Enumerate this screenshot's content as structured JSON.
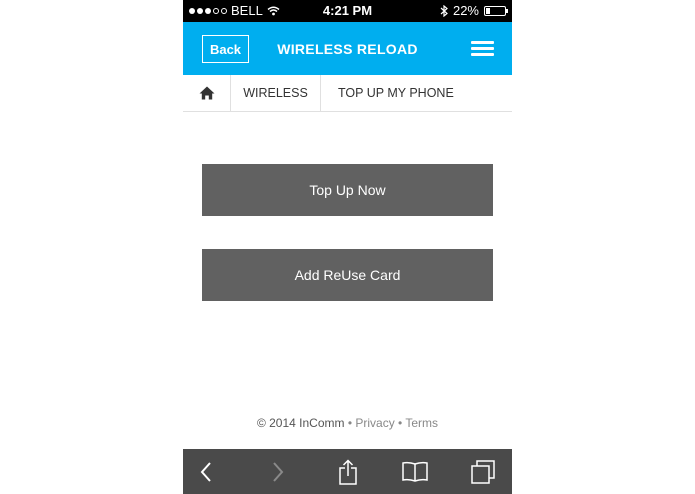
{
  "status_bar": {
    "carrier": "BELL",
    "time": "4:21 PM",
    "battery": "22%",
    "battery_level": 0.22
  },
  "header": {
    "back_label": "Back",
    "title": "WIRELESS RELOAD",
    "menu_icon": "hamburger-icon",
    "color": "#00aeef"
  },
  "breadcrumb": {
    "home_icon": "home-icon",
    "items": [
      "WIRELESS",
      "TOP UP MY PHONE"
    ]
  },
  "actions": {
    "top_up_label": "Top Up Now",
    "add_card_label": "Add ReUse Card",
    "button_color": "#616161"
  },
  "footer": {
    "copyright": "© 2014 InComm",
    "sep1": " • ",
    "privacy": "Privacy",
    "sep2": " • ",
    "terms": "Terms"
  },
  "toolbar": {
    "icons": [
      "back-icon",
      "forward-icon",
      "share-icon",
      "bookmarks-icon",
      "tabs-icon"
    ]
  }
}
